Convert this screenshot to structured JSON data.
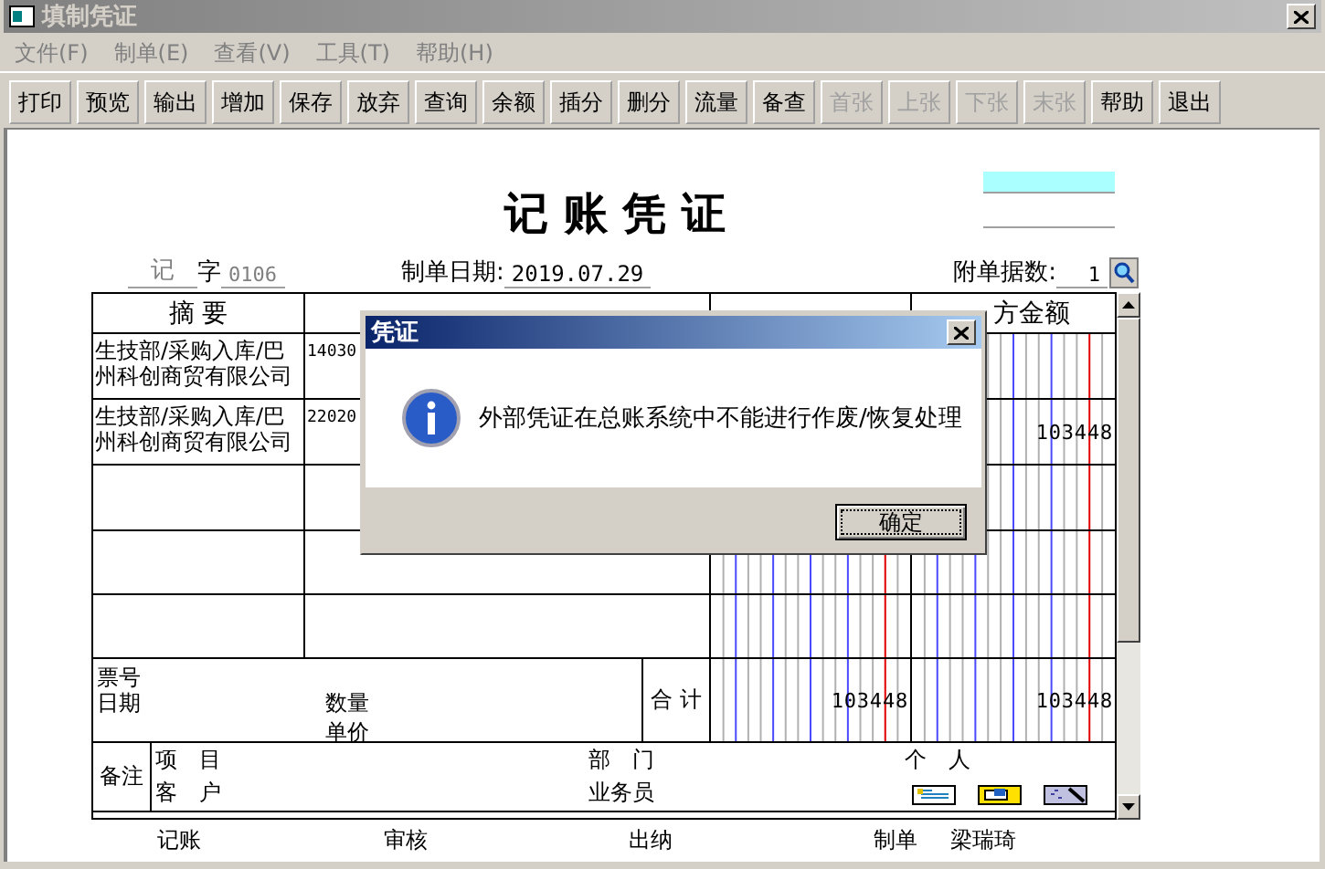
{
  "window": {
    "title": "填制凭证"
  },
  "menu": [
    {
      "label": "文件(F)"
    },
    {
      "label": "制单(E)"
    },
    {
      "label": "查看(V)"
    },
    {
      "label": "工具(T)"
    },
    {
      "label": "帮助(H)"
    }
  ],
  "toolbar": [
    {
      "label": "打印",
      "disabled": false
    },
    {
      "label": "预览",
      "disabled": false
    },
    {
      "label": "输出",
      "disabled": false
    },
    {
      "label": "增加",
      "disabled": false
    },
    {
      "label": "保存",
      "disabled": false
    },
    {
      "label": "放弃",
      "disabled": false
    },
    {
      "label": "查询",
      "disabled": false
    },
    {
      "label": "余额",
      "disabled": false
    },
    {
      "label": "插分",
      "disabled": false
    },
    {
      "label": "删分",
      "disabled": false
    },
    {
      "label": "流量",
      "disabled": false
    },
    {
      "label": "备查",
      "disabled": false
    },
    {
      "label": "首张",
      "disabled": true
    },
    {
      "label": "上张",
      "disabled": true
    },
    {
      "label": "下张",
      "disabled": true
    },
    {
      "label": "末张",
      "disabled": true
    },
    {
      "label": "帮助",
      "disabled": false
    },
    {
      "label": "退出",
      "disabled": false
    }
  ],
  "voucher": {
    "title": "记 账 凭 证",
    "type": "记",
    "word": "字",
    "number": "0106",
    "date_label": "制单日期:",
    "date": "2019.07.29",
    "attachments_label": "附单据数:",
    "attachments": "1",
    "columns": {
      "summary": "摘 要",
      "credit": "方金额"
    },
    "rows": [
      {
        "summary": "生技部/采购入库/巴州科创商贸有限公司",
        "account": "14030"
      },
      {
        "summary": "生技部/采购入库/巴州科创商贸有限公司",
        "account": "22020",
        "credit": "103448"
      }
    ],
    "totals": {
      "ticket_label": "票号",
      "date_label": "日期",
      "quantity_label": "数量",
      "price_label": "单价",
      "total_label": "合 计",
      "debit_total": "103448",
      "credit_total": "103448"
    },
    "remarks": {
      "label": "备注",
      "project_label": "项　目",
      "customer_label": "客　户",
      "department_label": "部　门",
      "salesperson_label": "业务员",
      "person_label": "个　人"
    },
    "signatures": [
      {
        "label": "记账"
      },
      {
        "label": "审核"
      },
      {
        "label": "出纳"
      },
      {
        "label": "制单",
        "name": "梁瑞琦"
      }
    ]
  },
  "dialog": {
    "title": "凭证",
    "message": "外部凭证在总账系统中不能进行作废/恢复处理",
    "button": "确定"
  }
}
